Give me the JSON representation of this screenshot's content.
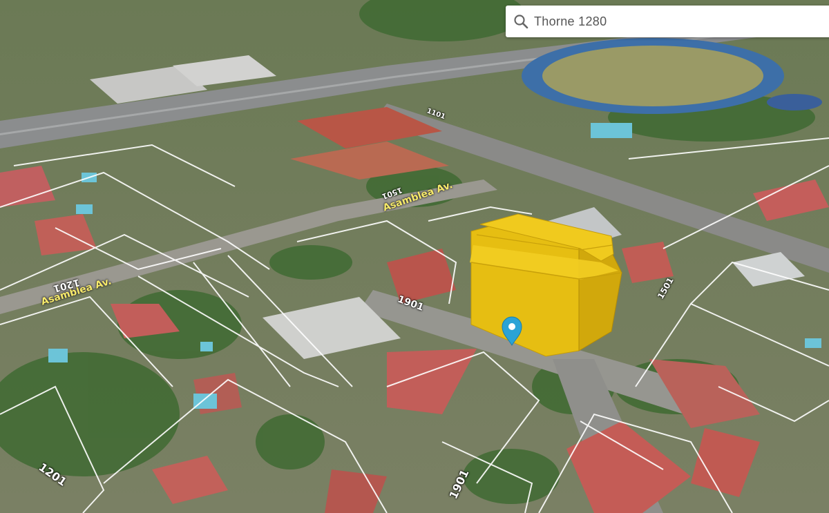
{
  "search": {
    "query": "Thorne 1280"
  },
  "streets": [
    {
      "name": "Asamblea Av."
    },
    {
      "name": "Asamblea Av."
    }
  ],
  "lot_numbers": [
    "1501",
    "1201",
    "1901",
    "1201",
    "1901",
    "1101",
    "1501"
  ],
  "colors": {
    "building": "#e6be12",
    "pin": "#2ba3d6",
    "parcel_outline": "#ffffff",
    "street_label": "#f6ea6a"
  }
}
